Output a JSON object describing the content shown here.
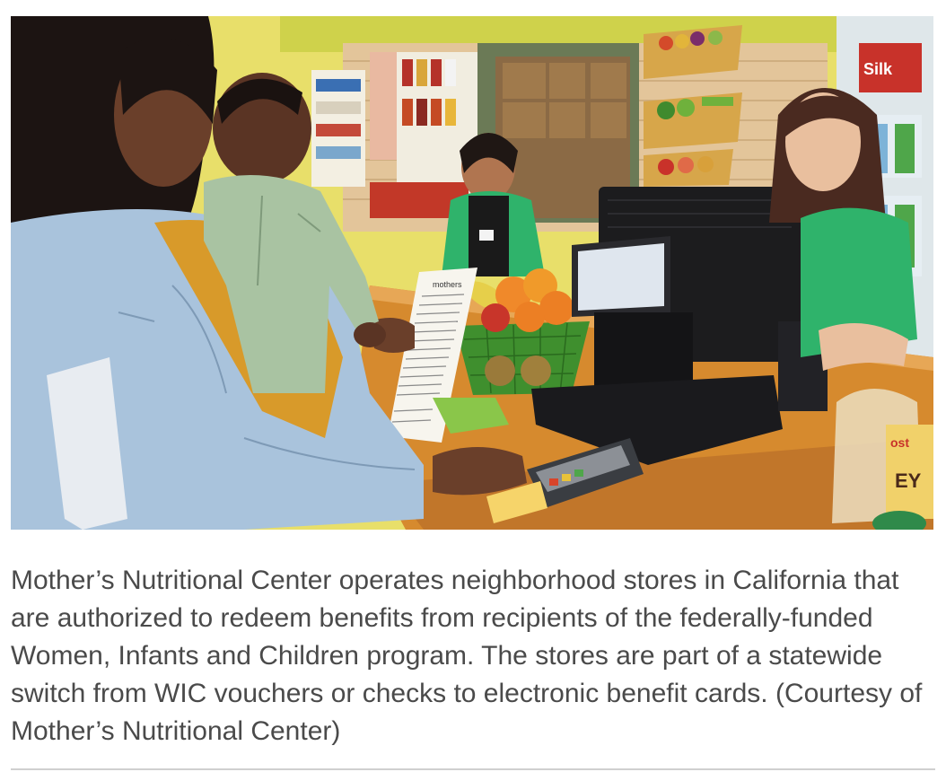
{
  "photo": {
    "alt": "Mother's Nutritional Center store checkout",
    "receipt_header": "mothers",
    "shelf_brand_label": "Silk",
    "bread_label": "ost",
    "bread_label_2": "EY"
  },
  "caption": {
    "text": "Mother’s Nutritional Center operates neighborhood stores in California that are authorized to redeem benefits from recipients of the federally-funded Women, Infants and Children program. The stores are part of a statewide switch from WIC vouchers or checks to electronic benefit cards. (Courtesy of Mother’s Nutritional Center)"
  },
  "colors": {
    "wall_yellow": "#e8df6a",
    "counter_orange": "#d68a2e",
    "uniform_green": "#2fb36b",
    "denim": "#a9c3dc"
  }
}
